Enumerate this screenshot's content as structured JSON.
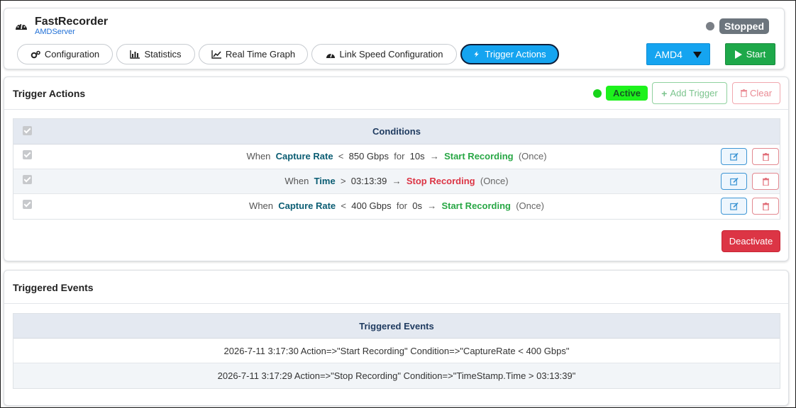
{
  "app": {
    "title": "FastRecorder",
    "server": "AMDServer",
    "status": "Stopped",
    "status_color": "#6c757d"
  },
  "tabs": [
    {
      "label": "Configuration",
      "icon": "gears-icon"
    },
    {
      "label": "Statistics",
      "icon": "bar-chart-icon"
    },
    {
      "label": "Real Time Graph",
      "icon": "line-chart-icon"
    },
    {
      "label": "Link Speed Configuration",
      "icon": "speedometer-icon"
    },
    {
      "label": "Trigger Actions",
      "icon": "bolt-icon",
      "active": true
    }
  ],
  "device_select": {
    "value": "AMD4"
  },
  "start_button": {
    "label": "Start",
    "color": "#1ea84a"
  },
  "trigger_panel": {
    "title": "Trigger Actions",
    "status": "Active",
    "status_color": "#1df21c",
    "add_label": "Add Trigger",
    "clear_label": "Clear",
    "table_header": "Conditions",
    "rows": [
      {
        "when": "When",
        "field": "Capture Rate",
        "op": "<",
        "value": "850 Gbps",
        "for_kw": "for",
        "duration": "10s",
        "arrow": "→",
        "action": "Start Recording",
        "action_type": "start",
        "freq": "(Once)"
      },
      {
        "when": "When",
        "field": "Time",
        "op": ">",
        "value": "03:13:39",
        "arrow": "→",
        "action": "Stop Recording",
        "action_type": "stop",
        "freq": "(Once)"
      },
      {
        "when": "When",
        "field": "Capture Rate",
        "op": "<",
        "value": "400 Gbps",
        "for_kw": "for",
        "duration": "0s",
        "arrow": "→",
        "action": "Start Recording",
        "action_type": "start",
        "freq": "(Once)"
      }
    ],
    "deactivate_label": "Deactivate"
  },
  "events_panel": {
    "title": "Triggered Events",
    "table_header": "Triggered Events",
    "rows": [
      "2026-7-11 3:17:30 Action=>\"Start Recording\" Condition=>\"CaptureRate < 400 Gbps\"",
      "2026-7-11 3:17:29 Action=>\"Stop Recording\" Condition=>\"TimeStamp.Time > 03:13:39\""
    ]
  }
}
